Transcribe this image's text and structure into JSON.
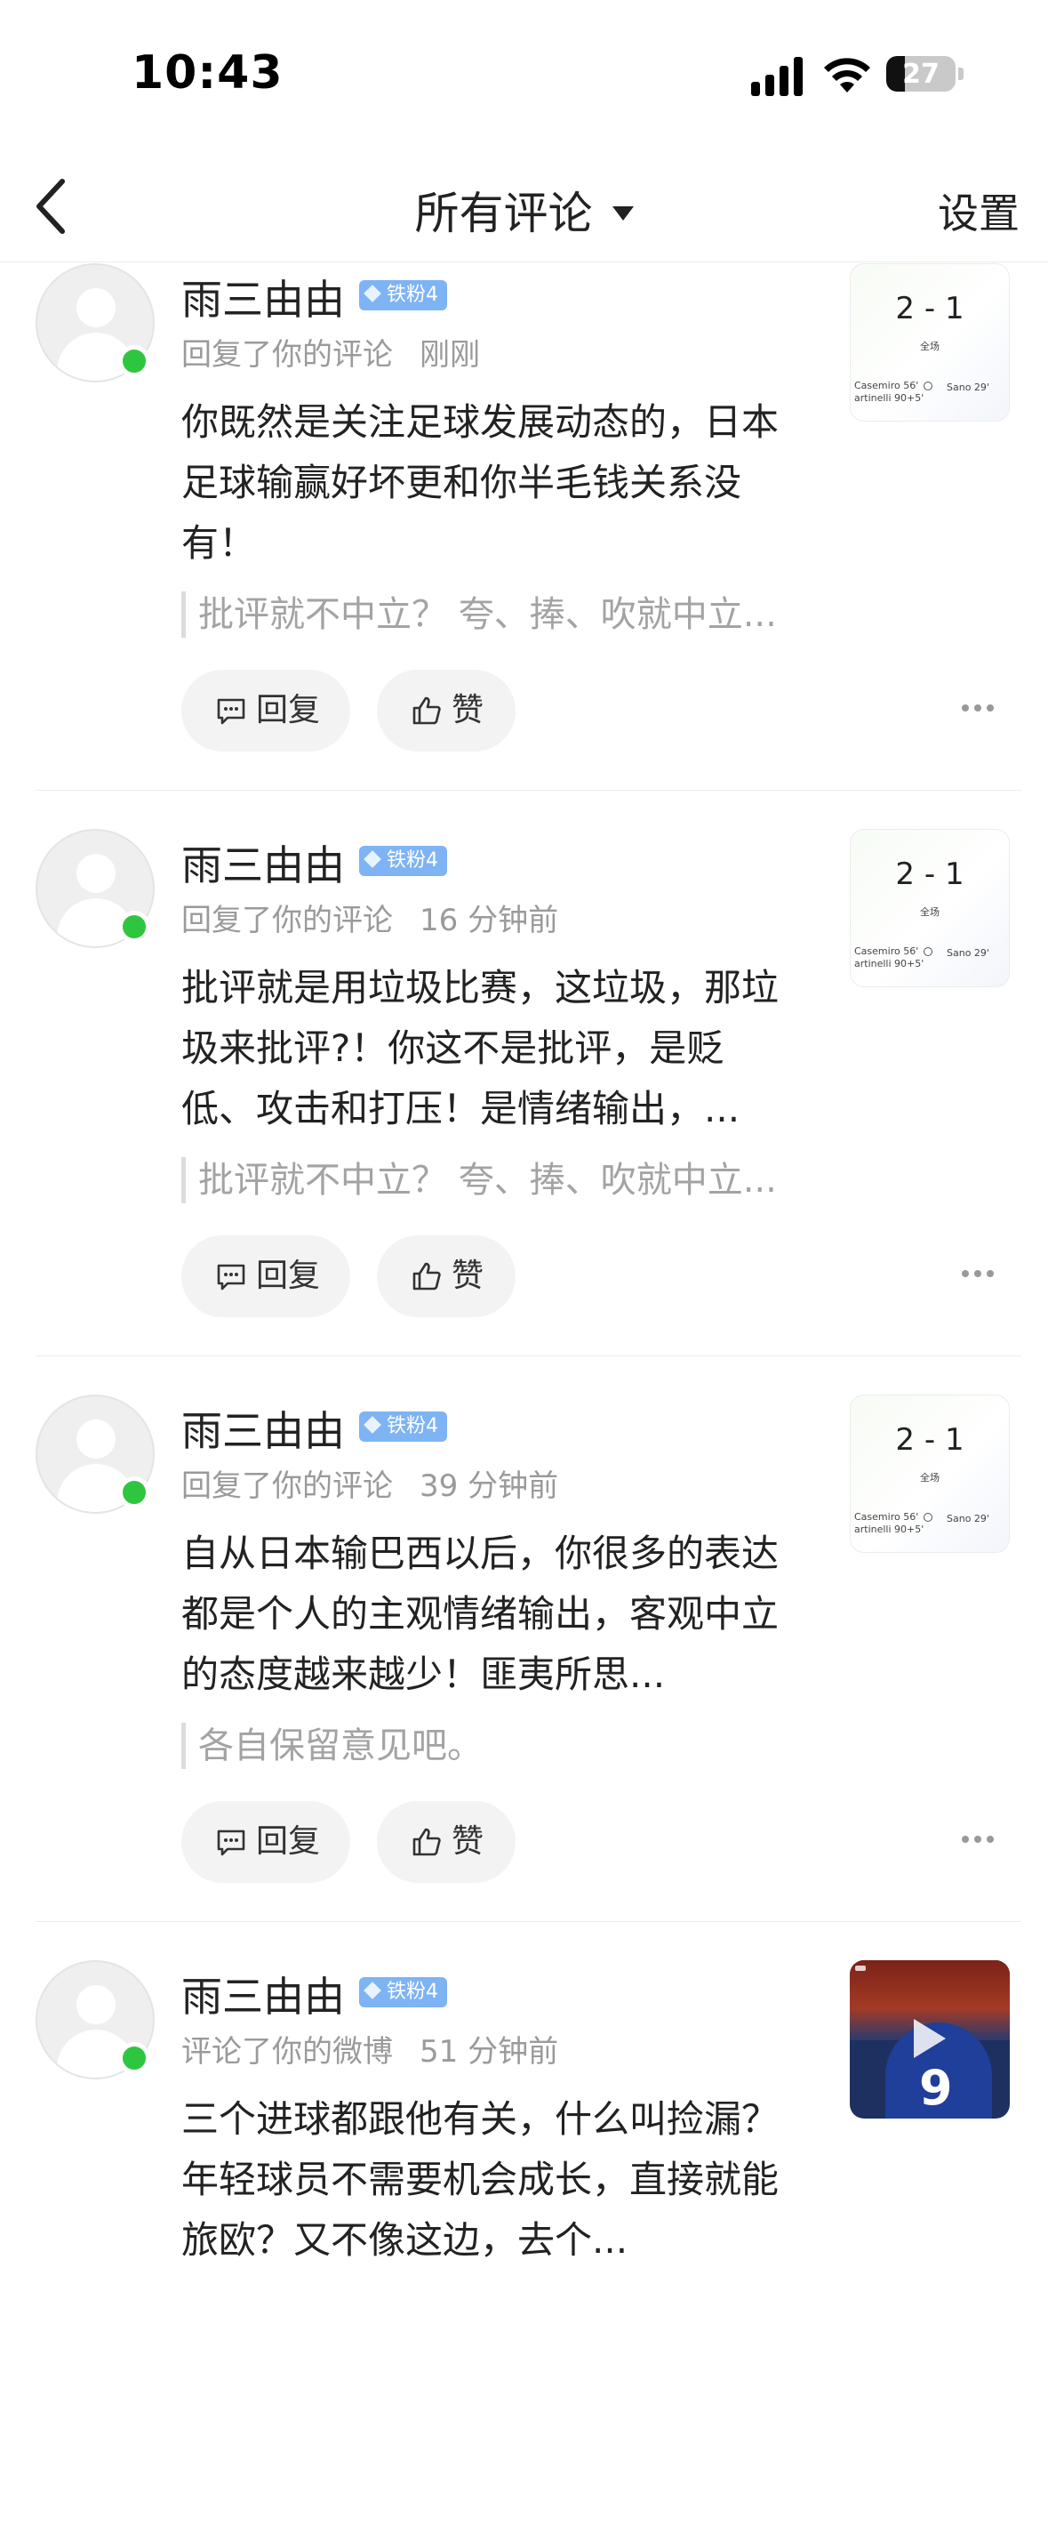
{
  "status_bar": {
    "time": "10:43",
    "battery_percent": "27",
    "battery_level": 0.27
  },
  "nav": {
    "title": "所有评论",
    "settings_label": "设置"
  },
  "actions": {
    "reply_label": "回复",
    "like_label": "赞"
  },
  "comments": [
    {
      "username": "雨三由由",
      "badge": "铁粉4",
      "action": "回复了你的评论",
      "time": "刚刚",
      "text": "你既然是关注足球发展动态的，日本足球输赢好坏更和你半毛钱关系没有！",
      "quote": "批评就不中立？ 夸、捧、吹就中立...",
      "thumbnail": {
        "type": "score-card",
        "score": "2 - 1",
        "sub": "全场",
        "scorer_left": "Casemiro 56'\nartinelli 90+5'",
        "scorer_right": "Sano 29'"
      }
    },
    {
      "username": "雨三由由",
      "badge": "铁粉4",
      "action": "回复了你的评论",
      "time": "16 分钟前",
      "text": "批评就是用垃圾比赛，这垃圾，那垃圾来批评?！你这不是批评，是贬低、攻击和打压！是情绪输出，...",
      "quote": "批评就不中立？ 夸、捧、吹就中立...",
      "thumbnail": {
        "type": "score-card",
        "score": "2 - 1",
        "sub": "全场",
        "scorer_left": "Casemiro 56'\nartinelli 90+5'",
        "scorer_right": "Sano 29'"
      }
    },
    {
      "username": "雨三由由",
      "badge": "铁粉4",
      "action": "回复了你的评论",
      "time": "39 分钟前",
      "text": "自从日本输巴西以后，你很多的表达都是个人的主观情绪输出，客观中立的态度越来越少！匪夷所思...",
      "quote": "各自保留意见吧。",
      "thumbnail": {
        "type": "score-card",
        "score": "2 - 1",
        "sub": "全场",
        "scorer_left": "Casemiro 56'\nartinelli 90+5'",
        "scorer_right": "Sano 29'"
      }
    },
    {
      "username": "雨三由由",
      "badge": "铁粉4",
      "action": "评论了你的微博",
      "time": "51 分钟前",
      "text": "三个进球都跟他有关，什么叫捡漏？ 年轻球员不需要机会成长，直接就能旅欧？又不像这边，去个...",
      "thumbnail": {
        "type": "video",
        "jersey_number": "9"
      }
    }
  ]
}
